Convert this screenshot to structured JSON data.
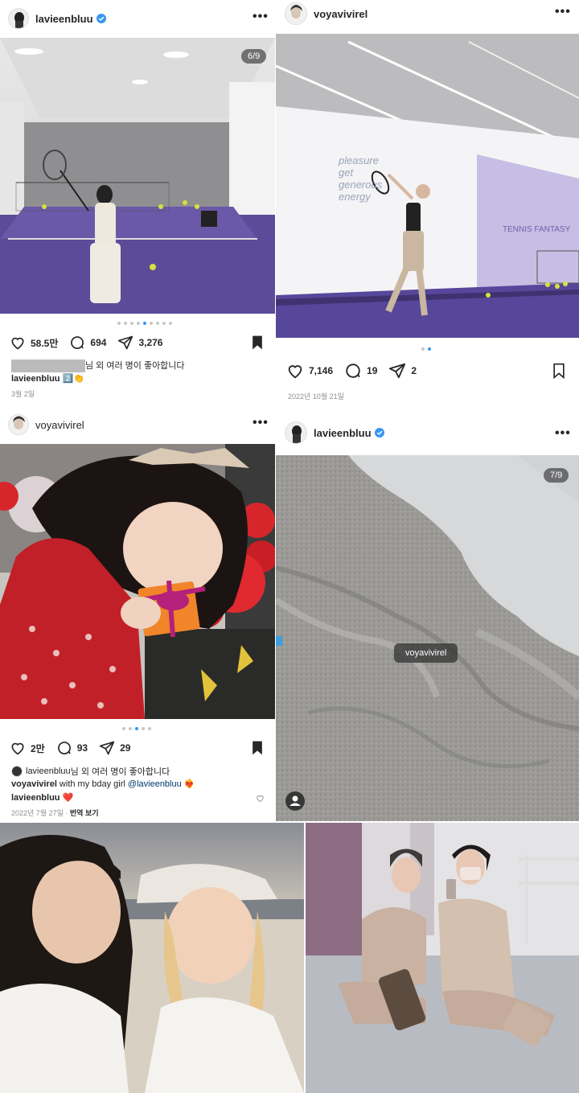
{
  "posts": {
    "p1": {
      "username": "lavieenbluu",
      "counter": "6/9",
      "likes": "58.5만",
      "comments": "694",
      "shares": "3,276",
      "liked_by_suffix": "님 외 여러 명이 좋아합니다",
      "caption_user": "lavieenbluu",
      "caption_text": "2️⃣👏",
      "date": "3월 2일"
    },
    "p2": {
      "username": "voyavivirel",
      "wall_text": "pleasure\nget\ngenerous\nenergy",
      "wall_text2": "TENNIS FANTASY",
      "likes": "7,146",
      "comments": "19",
      "shares": "2",
      "date": "2022년 10월 21일"
    },
    "p3": {
      "username": "voyavivirel",
      "likes": "2만",
      "comments": "93",
      "shares": "29",
      "liked_by_user": "lavieenbluu",
      "liked_by_suffix": "님 외 여러 명이 좋아합니다",
      "caption_user": "voyavivirel",
      "caption_text": " with my bday girl ",
      "caption_mention": "@lavieenbluu",
      "caption_emoji": "❤️‍🔥",
      "comment_user": "lavieenbluu",
      "comment_text": "❤️",
      "date": "2022년 7월 27일",
      "translate": "번역 보기"
    },
    "p4": {
      "username": "lavieenbluu",
      "counter": "7/9",
      "tag": "voyavivirel"
    }
  },
  "colors": {
    "accent": "#3897f0",
    "court_purple": "#5a4a9a",
    "verified_blue": "#3897f0"
  },
  "icons": [
    "heart-icon",
    "comment-icon",
    "share-icon",
    "bookmark-icon",
    "more-icon",
    "verified-badge-icon",
    "person-tag-icon"
  ]
}
